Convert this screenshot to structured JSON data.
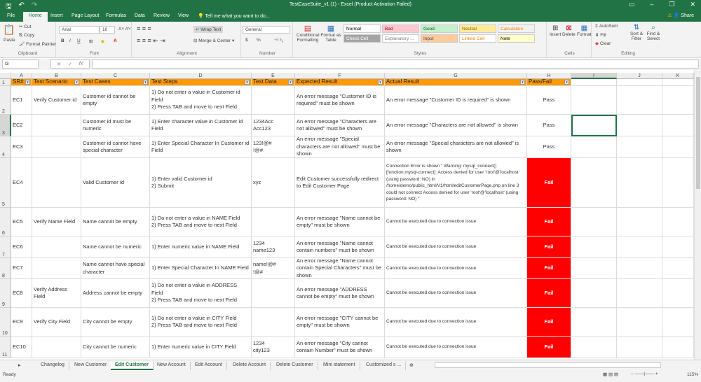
{
  "window": {
    "title": "TestCaseSuite_v1 (1) - Excel (Product Activation Failed)",
    "share": "Share"
  },
  "ribbon_tabs": [
    "File",
    "Home",
    "Insert",
    "Page Layout",
    "Formulas",
    "Data",
    "Review",
    "View"
  ],
  "tell_me": "Tell me what you want to do...",
  "clipboard": {
    "paste": "Paste",
    "cut": "Cut",
    "copy": "Copy",
    "format_painter": "Format Painter",
    "label": "Clipboard"
  },
  "font": {
    "name": "Arial",
    "size": "10",
    "label": "Font",
    "bold": "B",
    "italic": "I",
    "underline": "U"
  },
  "alignment": {
    "wrap": "Wrap Text",
    "merge": "Merge & Center",
    "label": "Alignment"
  },
  "number": {
    "format": "General",
    "label": "Number",
    "currency": "$",
    "percent": "%"
  },
  "styles": {
    "conditional": "Conditional Formatting",
    "format_table": "Format as Table",
    "label": "Styles",
    "items": [
      {
        "name": "Normal",
        "bg": "#ffffff",
        "fg": "#000000"
      },
      {
        "name": "Bad",
        "bg": "#ffc7ce",
        "fg": "#9c0006"
      },
      {
        "name": "Good",
        "bg": "#c6efce",
        "fg": "#006100"
      },
      {
        "name": "Neutral",
        "bg": "#ffeb9c",
        "fg": "#9c5700"
      },
      {
        "name": "Calculation",
        "bg": "#f2f2f2",
        "fg": "#fa7d00"
      },
      {
        "name": "Check Cell",
        "bg": "#a5a5a5",
        "fg": "#ffffff"
      },
      {
        "name": "Explanatory ...",
        "bg": "#ffffff",
        "fg": "#7f7f7f"
      },
      {
        "name": "Input",
        "bg": "#ffcc99",
        "fg": "#3f3f76"
      },
      {
        "name": "Linked Cell",
        "bg": "#ffffff",
        "fg": "#fa7d00"
      },
      {
        "name": "Note",
        "bg": "#ffffcc",
        "fg": "#000000"
      }
    ]
  },
  "cells_group": {
    "insert": "Insert",
    "delete": "Delete",
    "format": "Format",
    "label": "Cells"
  },
  "editing": {
    "autosum": "AutoSum",
    "fill": "Fill",
    "clear": "Clear",
    "sort": "Sort & Filter",
    "find": "Find & Select",
    "label": "Editing"
  },
  "formula_bar": {
    "name_box": "I3",
    "value": ""
  },
  "columns": [
    "A",
    "B",
    "C",
    "D",
    "E",
    "F",
    "G",
    "H",
    "I",
    "J",
    "K"
  ],
  "headers": [
    "SR#",
    "Test Scenario",
    "Test Cases",
    "Test Steps",
    "Test Data",
    "Expected Result",
    "Actual Result",
    "Pass/Fail"
  ],
  "rows": [
    {
      "n": "2",
      "c": [
        "EC1",
        "Verify Customer id",
        "Customer id cannot be empty",
        "1) Do not enter a value in Customer id Field\n2) Press TAB and move to next Field",
        "",
        "An error message \"Customer ID is required\" must be shown",
        "An error message \"Customer ID is required\" is shown",
        "Pass"
      ]
    },
    {
      "n": "3",
      "c": [
        "EC2",
        "",
        "Customer id must be numeric",
        "1) Enter character value in Customer id Field",
        "1234Acc\nAcc123",
        "An error message \"Characters are not allowed\" must be shown",
        "An error message \"Characters are not allowed\" is shown",
        "Pass"
      ]
    },
    {
      "n": "4",
      "c": [
        "EC3",
        "",
        "Customer id cannot have special character",
        "1) Enter Special Character In Customer id  Field",
        "123!@#\n!@#",
        "An error message \"Special characters are not allowed\" must be shown",
        "An error message \"Special characters are not allowed\" is shown",
        "Pass"
      ]
    },
    {
      "n": "5",
      "c": [
        "EC4",
        "",
        "Valid Customer Id",
        "1) Enter valid Customer id\n2) Submit",
        "xyz",
        "Edit Customer successfully redirect to Edit Customer Page",
        "Connection Error is shown \" Warning: mysql_connect() [function.mysql-connect]: Access denied for user 'root'@'localhost' (using password: NO) in /home/demo/public_html/V1/html/editCustomerPage.php on line 3\ncould not connect Access denied for user 'root'@'localhost' (using password: NO) \"",
        "Fail"
      ]
    },
    {
      "n": "6",
      "c": [
        "EC5",
        "Verify Name Field",
        "Name cannot be empty",
        "1) Do not enter a value in NAME Field\n2) Press TAB and move to next Field",
        "",
        "An error message \"Name cannot be empty\" must be shown",
        "Cannot be executed due to connection issue",
        "Fail"
      ]
    },
    {
      "n": "7",
      "c": [
        "EC6",
        "",
        "Name cannot be numeric",
        "1) Enter numeric value in NAME Field",
        "1234\nname123",
        "An error message \"Name cannot contain numbers\" must be shown",
        "Cannot be executed due to connection issue",
        "Fail"
      ]
    },
    {
      "n": "8",
      "c": [
        "EC7",
        "",
        "Name cannot have special character",
        "1) Enter Special Character In NAME Field",
        "name!@#\n!@#",
        "An error message \"Name cannot contain Special Characters\" must be shown",
        "Cannot be executed due to connection issue",
        "Fail"
      ]
    },
    {
      "n": "9",
      "c": [
        "EC8",
        "Verify Address Field",
        "Address cannot be empty",
        "1) Do not enter a value in ADDRESS Field\n2) Press TAB and move to next Field",
        "",
        "An error message \"ADDRESS cannot be empty\" must be shown",
        "Cannot be executed due to connection issue",
        "Fail"
      ]
    },
    {
      "n": "10",
      "c": [
        "EC9",
        "Verify City Field",
        "City cannot be empty",
        "1) Do not enter a value in CITY Field\n2) Press TAB and move to next Field",
        "",
        "An error message \"CITY cannot be empty\" must be shown",
        "Cannot be executed due to connection issue",
        "Fail"
      ]
    },
    {
      "n": "11",
      "c": [
        "EC10",
        "",
        "City cannot be numeric",
        "1) Enter numeric value in CITY Field",
        "1234\ncity123",
        "An error message \"City cannot contain Number\" must be shown",
        "Cannot be executed due to connection issue",
        "Fail"
      ]
    }
  ],
  "sheet_tabs": [
    "Changelog",
    "New Customer",
    "Edit Customer",
    "New Account",
    "Edit Account",
    "Delete Account",
    "Delete  Customer",
    "Mini statement",
    "Customized s ..."
  ],
  "active_sheet": "Edit Customer",
  "status": {
    "ready": "Ready",
    "zoom": "115%"
  },
  "colors": {
    "header": "#ff9900",
    "fail": "#ff0000",
    "brand": "#217346"
  }
}
